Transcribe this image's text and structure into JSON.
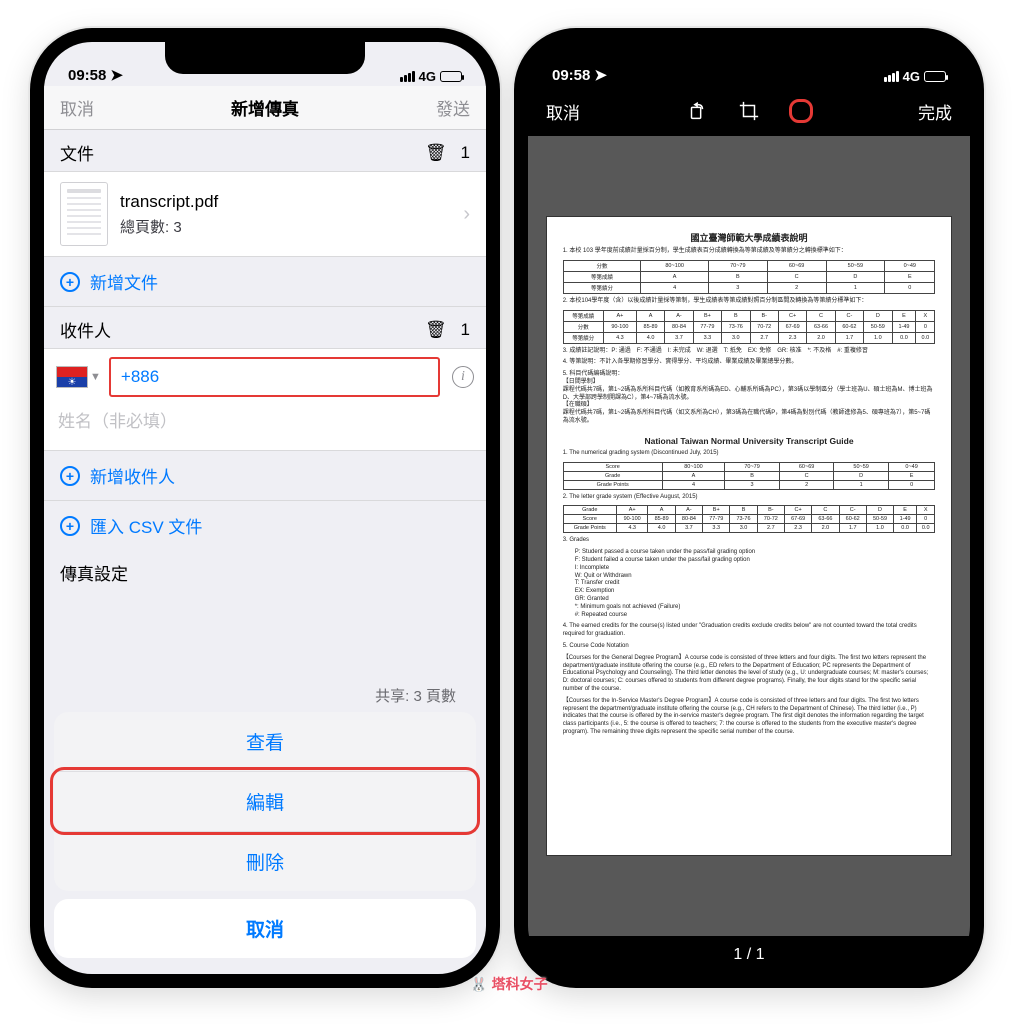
{
  "status": {
    "time": "09:58",
    "network": "4G"
  },
  "left": {
    "nav": {
      "cancel": "取消",
      "title": "新增傳真",
      "send": "發送"
    },
    "doc_section": {
      "label": "文件",
      "count": "1"
    },
    "doc": {
      "filename": "transcript.pdf",
      "pages": "總頁數: 3"
    },
    "add_doc": "新增文件",
    "recipient_section": {
      "label": "收件人",
      "count": "1"
    },
    "phone_code": "+886",
    "name_placeholder": "姓名（非必填）",
    "add_recipient": "新增收件人",
    "import_csv": "匯入 CSV 文件",
    "settings_label": "傳真設定",
    "peek": "共享: 3 頁數",
    "sheet": {
      "view": "查看",
      "edit": "編輯",
      "delete": "刪除",
      "cancel": "取消"
    }
  },
  "right": {
    "nav": {
      "cancel": "取消",
      "done": "完成"
    },
    "doc_title_zh": "國立臺灣師範大學成績表說明",
    "doc_title_en": "National Taiwan Normal University Transcript Guide",
    "line1": "1. 本校 103 學年度前成績計量採百分制，學生成績表百分成績轉換為等第成績及等第績分之轉換標準如下：",
    "table1_rows": [
      [
        "分數",
        "80~100",
        "70~79",
        "60~69",
        "50~59",
        "0~49"
      ],
      [
        "等第成績",
        "A",
        "B",
        "C",
        "D",
        "E"
      ],
      [
        "等第績分",
        "4",
        "3",
        "2",
        "1",
        "0"
      ]
    ],
    "line2": "2. 本校104學年度（含）以後成績計量採等第制，學生成績表等第成績對照百分制區間及轉換為等第績分標準如下：",
    "table2_rows": [
      [
        "等第成績",
        "A+",
        "A",
        "A-",
        "B+",
        "B",
        "B-",
        "C+",
        "C",
        "C-",
        "D",
        "E",
        "X"
      ],
      [
        "分數",
        "90-100",
        "85-89",
        "80-84",
        "77-79",
        "73-76",
        "70-72",
        "67-69",
        "63-66",
        "60-62",
        "50-59",
        "1-49",
        "0"
      ],
      [
        "等第績分",
        "4.3",
        "4.0",
        "3.7",
        "3.3",
        "3.0",
        "2.7",
        "2.3",
        "2.0",
        "1.7",
        "1.0",
        "0.0",
        "0.0"
      ]
    ],
    "en_sec1": "1. The numerical grading system (Discontinued July, 2015)",
    "table3_rows": [
      [
        "Score",
        "80~100",
        "70~79",
        "60~69",
        "50~59",
        "0~49"
      ],
      [
        "Grade",
        "A",
        "B",
        "C",
        "D",
        "E"
      ],
      [
        "Grade Points",
        "4",
        "3",
        "2",
        "1",
        "0"
      ]
    ],
    "en_sec2": "2. The letter grade system (Effective August, 2015)",
    "table4_rows": [
      [
        "Grade",
        "A+",
        "A",
        "A-",
        "B+",
        "B",
        "B-",
        "C+",
        "C",
        "C-",
        "D",
        "E",
        "X"
      ],
      [
        "Score",
        "90-100",
        "85-89",
        "80-84",
        "77-79",
        "73-76",
        "70-72",
        "67-69",
        "63-66",
        "60-62",
        "50-59",
        "1-49",
        "0"
      ],
      [
        "Grade Points",
        "4.3",
        "4.0",
        "3.7",
        "3.3",
        "3.0",
        "2.7",
        "2.3",
        "2.0",
        "1.7",
        "1.0",
        "0.0",
        "0.0"
      ]
    ],
    "grades_label": "3. Grades",
    "grade_legend": [
      "P:   Student passed a course taken under the pass/fail grading option",
      "F:   Student failed a course taken under the pass/fail grading option",
      "I:   Incomplete",
      "W:  Quit or Withdrawn",
      "T:   Transfer credit",
      "EX: Exemption",
      "GR: Granted",
      "*:   Minimum goals not achieved (Failure)",
      "#:   Repeated course"
    ],
    "en_sec4": "4. The earned credits for the course(s) listed under \"Graduation credits exclude credits below\" are not counted toward the total credits required for graduation.",
    "en_sec5": "5. Course Code Notation",
    "notation_p1": "【Courses for the General Degree Program】A course code is consisted of three letters and four digits. The first two letters represent the department/graduate institute offering the course (e.g., ED refers to the Department of Education; PC represents the Department of Educational Psychology and Counseling). The third letter denotes the level of study (e.g., U: undergraduate courses; M: master's courses; D: doctoral courses; C: courses offered to students from different degree programs). Finally, the four digits stand for the specific serial number of the course.",
    "notation_p2": "【Courses for the In-Service Master's Degree Program】A course code is consisted of three letters and four digits. The first two letters represent the department/graduate institute offering the course (e.g., CH refers to the Department of Chinese). The third letter (i.e., P) indicates that the course is offered by the in-service master's degree program. The first digit denotes the information regarding the target class participants (i.e., 5: the course is offered to teachers; 7: the course is offered to the students from the executive master's degree program). The remaining three digits represent the specific serial number of the course.",
    "page_ind": "1 / 1"
  },
  "watermark": "塔科女子"
}
